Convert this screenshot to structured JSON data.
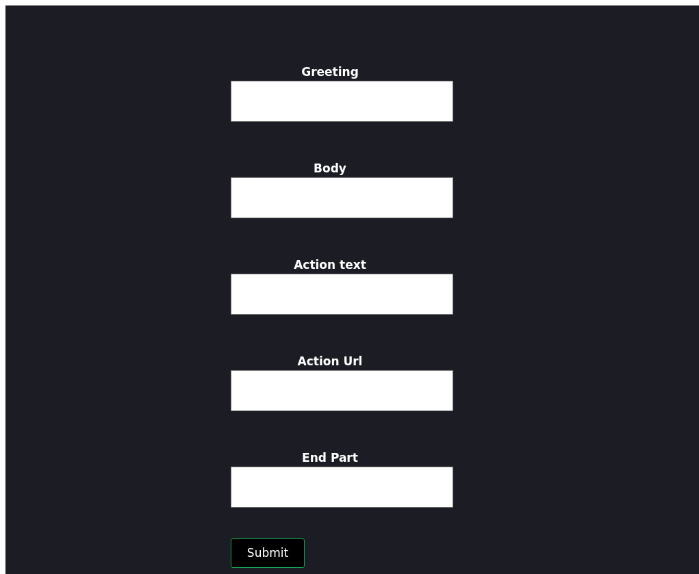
{
  "form": {
    "fields": [
      {
        "label": "Greeting"
      },
      {
        "label": "Body"
      },
      {
        "label": "Action text"
      },
      {
        "label": "Action Url"
      },
      {
        "label": "End Part"
      }
    ],
    "submit": "Submit"
  }
}
